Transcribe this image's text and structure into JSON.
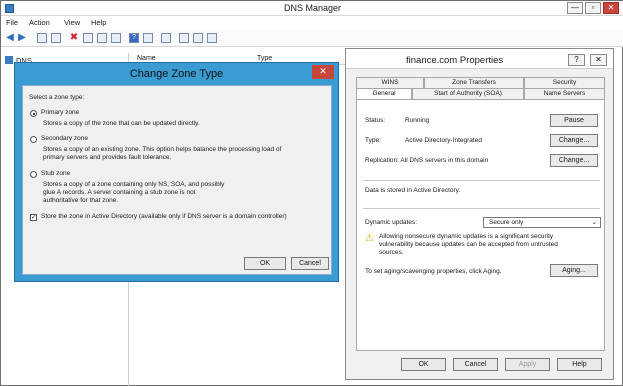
{
  "window": {
    "title": "DNS Manager",
    "minimize": "—",
    "maximize": "▫",
    "close": "✕"
  },
  "menu": [
    "File",
    "Action",
    "View",
    "Help"
  ],
  "tree": {
    "root": "DNS"
  },
  "list": {
    "col_name": "Name",
    "col_type": "Type"
  },
  "change_zone": {
    "title": "Change Zone Type",
    "close": "✕",
    "prompt": "Select a zone type:",
    "primary_label": "Primary zone",
    "primary_desc": "Stores a copy of the zone that can be updated directly.",
    "secondary_label": "Secondary zone",
    "secondary_desc_1": "Stores a copy of an existing zone. This option helps balance the processing load of",
    "secondary_desc_2": "primary servers and provides fault tolerance.",
    "stub_label": "Stub zone",
    "stub_desc_1": "Stores a copy of a zone containing only NS, SOA, and possibly",
    "stub_desc_2": "glue A records. A server containing a stub zone is not",
    "stub_desc_3": "authoritative for that zone.",
    "store_ad": "Store the zone in Active Directory (available only if DNS server is a domain controller)",
    "ok": "OK",
    "cancel": "Cancel"
  },
  "props": {
    "title": "finance.com Properties",
    "help": "?",
    "close": "✕",
    "tabs_back": [
      "WINS",
      "Zone Transfers",
      "Security"
    ],
    "tabs_front": [
      "General",
      "Start of Authority (SOA)",
      "Name Servers"
    ],
    "status_label": "Status:",
    "status_value": "Running",
    "pause": "Pause",
    "type_label": "Type:",
    "type_value": "Active Directory-Integrated",
    "change1": "Change...",
    "replication": "Replication:  All DNS servers in this domain",
    "change2": "Change...",
    "stored": "Data is stored in Active Directory.",
    "dyn_label": "Dynamic updates:",
    "dyn_value": "Secure only",
    "warning_1": "Allowing nonsecure dynamic updates is a significant security",
    "warning_2": "vulnerability because updates can be accepted from untrusted",
    "warning_3": "sources.",
    "aging_text": "To set aging/scavenging properties, click Aging.",
    "aging": "Aging...",
    "ok": "OK",
    "cancel": "Cancel",
    "apply": "Apply",
    "helpbtn": "Help"
  }
}
